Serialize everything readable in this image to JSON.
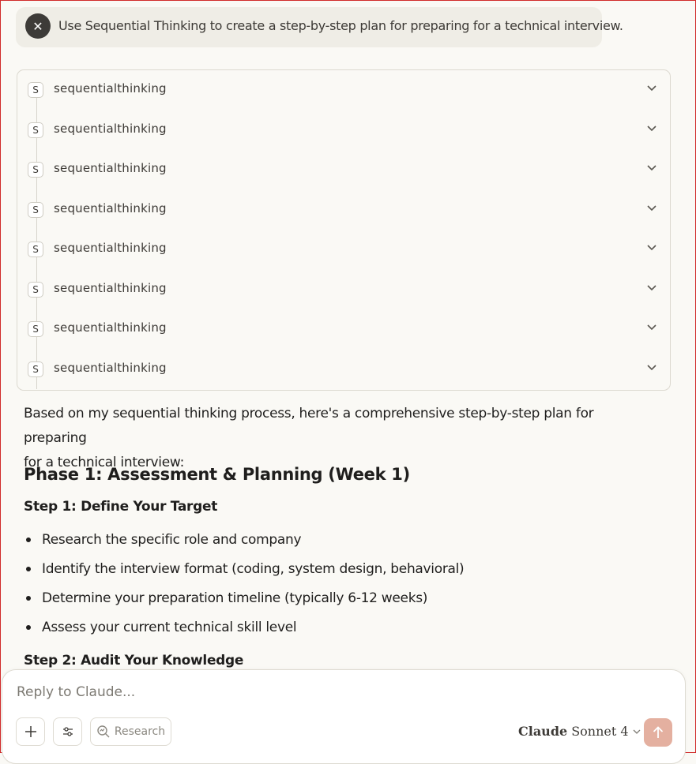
{
  "prompt": {
    "avatar_icon": "close-icon",
    "text": "Use Sequential Thinking to create a step-by-step plan for preparing for a technical interview."
  },
  "tool_calls": {
    "items": [
      {
        "badge": "S",
        "label": "sequentialthinking"
      },
      {
        "badge": "S",
        "label": "sequentialthinking"
      },
      {
        "badge": "S",
        "label": "sequentialthinking"
      },
      {
        "badge": "S",
        "label": "sequentialthinking"
      },
      {
        "badge": "S",
        "label": "sequentialthinking"
      },
      {
        "badge": "S",
        "label": "sequentialthinking"
      },
      {
        "badge": "S",
        "label": "sequentialthinking"
      },
      {
        "badge": "S",
        "label": "sequentialthinking"
      }
    ]
  },
  "response": {
    "intro_line1": "Based on my sequential thinking process, here's a comprehensive step-by-step plan for preparing",
    "intro_line2": "for a technical interview:",
    "phase1_heading": "Phase 1: Assessment & Planning (Week 1)",
    "step1_heading": "Step 1: Define Your Target",
    "step1_bullets": [
      "Research the specific role and company",
      "Identify the interview format (coding, system design, behavioral)",
      "Determine your preparation timeline (typically 6-12 weeks)",
      "Assess your current technical skill level"
    ],
    "step2_heading": "Step 2: Audit Your Knowledge"
  },
  "composer": {
    "placeholder": "Reply to Claude...",
    "research_label": "Research",
    "model_brand": "Claude",
    "model_name": "Sonnet 4"
  },
  "colors": {
    "background": "#faf9f5",
    "send_button": "#e4b0a0",
    "window_border": "#d12a2a"
  }
}
